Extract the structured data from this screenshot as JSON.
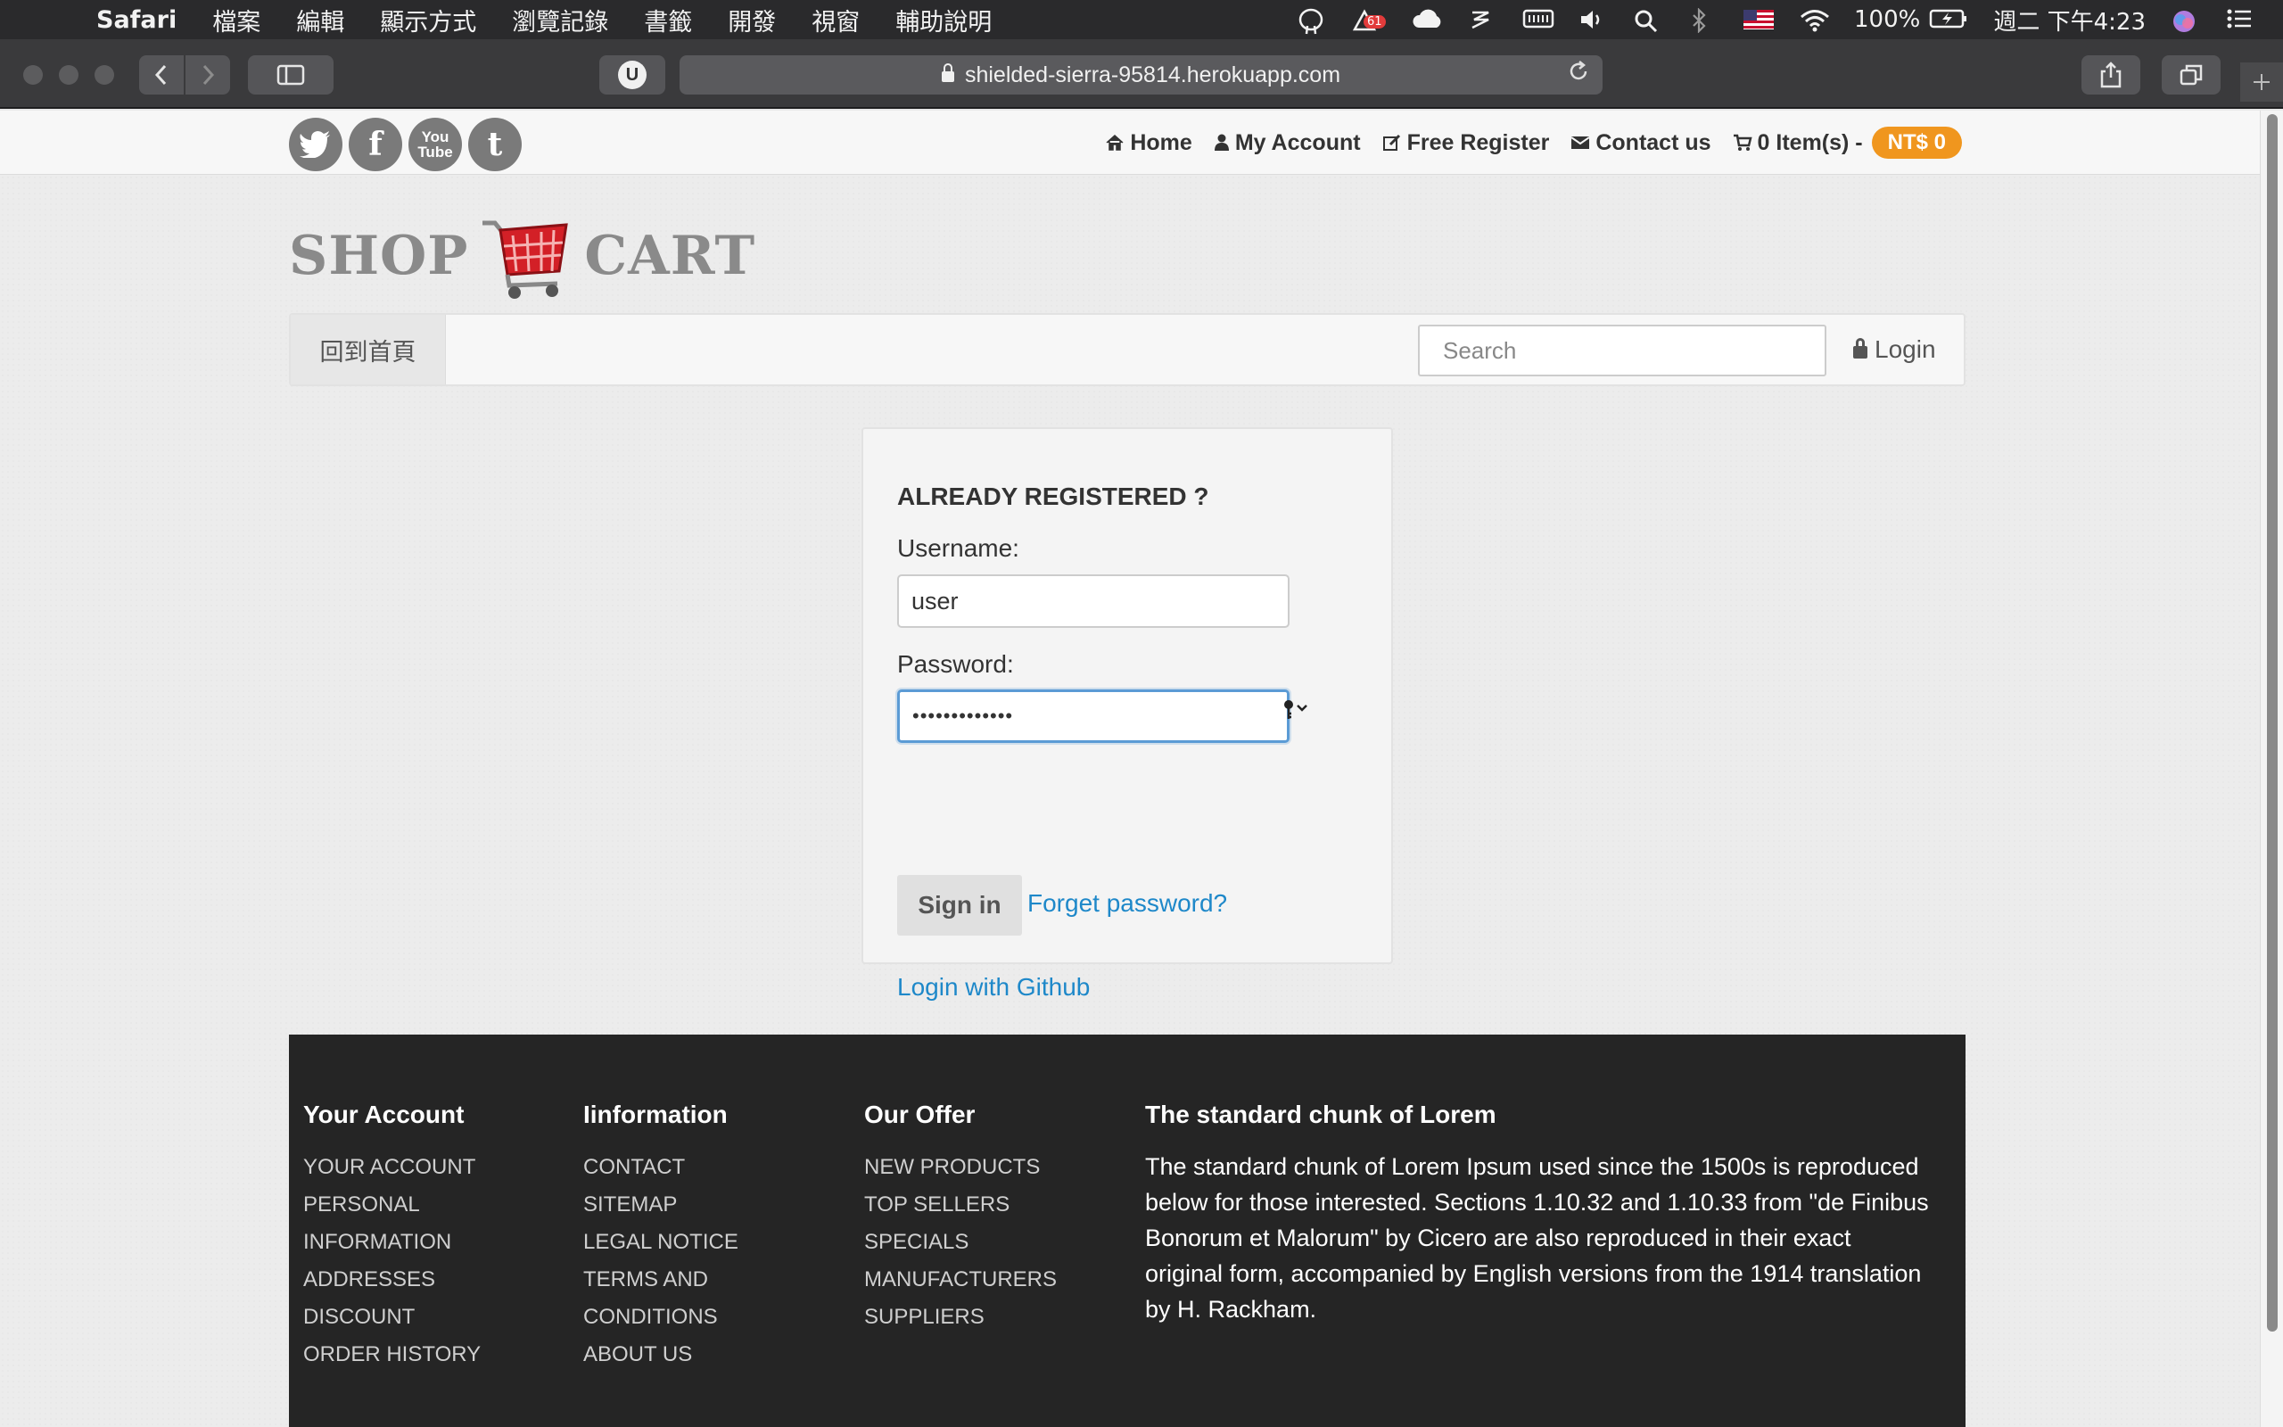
{
  "menubar": {
    "app": "Safari",
    "items": [
      "檔案",
      "編輯",
      "顯示方式",
      "瀏覽記錄",
      "書籤",
      "開發",
      "視窗",
      "輔助說明"
    ],
    "badge": "61",
    "battery": "100%",
    "clock": "週二 下午4:23"
  },
  "browser": {
    "url": "shielded-sierra-95814.herokuapp.com",
    "ext_label": "U"
  },
  "topnav": {
    "home": "Home",
    "account": "My Account",
    "register": "Free Register",
    "contact": "Contact us",
    "cart": "0 Item(s) -",
    "price": "NT$ 0"
  },
  "social": {
    "twitter": "twitter-icon",
    "facebook": "facebook-icon",
    "youtube_line1": "You",
    "youtube_line2": "Tube",
    "tumblr": "tumblr-icon"
  },
  "logo": {
    "left": "SHOP",
    "right": "CART"
  },
  "navbar": {
    "home": "回到首頁",
    "search_placeholder": "Search",
    "login": "Login"
  },
  "login": {
    "title": "ALREADY REGISTERED ?",
    "username_label": "Username:",
    "username_value": "user",
    "password_label": "Password:",
    "password_value": "•••••••••••••",
    "signin": "Sign in",
    "forgot": "Forget password?",
    "github": "Login with Github"
  },
  "footer": {
    "col1": {
      "heading": "Your Account",
      "links": [
        "YOUR ACCOUNT",
        "PERSONAL",
        "INFORMATION",
        "ADDRESSES",
        "DISCOUNT",
        "ORDER HISTORY"
      ]
    },
    "col2": {
      "heading": "Iinformation",
      "links": [
        "CONTACT",
        "SITEMAP",
        "LEGAL NOTICE",
        "TERMS AND",
        "CONDITIONS",
        "ABOUT US"
      ]
    },
    "col3": {
      "heading": "Our Offer",
      "links": [
        "NEW PRODUCTS",
        "TOP SELLERS",
        "SPECIALS",
        "MANUFACTURERS",
        "SUPPLIERS"
      ]
    },
    "col4": {
      "heading": "The standard chunk of Lorem",
      "text": "The standard chunk of Lorem Ipsum used since the 1500s is reproduced below for those interested. Sections 1.10.32 and 1.10.33 from \"de Finibus Bonorum et Malorum\" by Cicero are also reproduced in their exact original form, accompanied by English versions from the 1914 translation by H. Rackham."
    }
  }
}
